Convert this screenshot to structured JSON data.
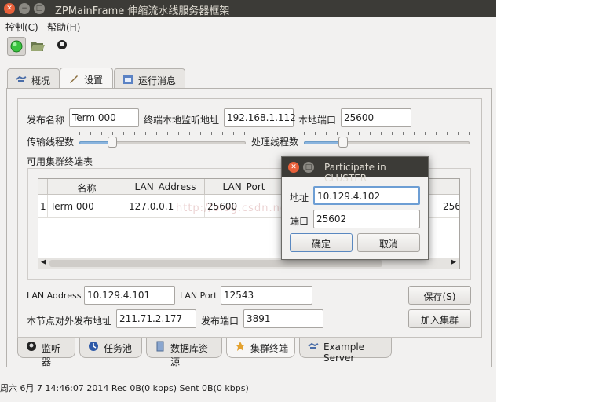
{
  "window": {
    "title": "ZPMainFrame 伸缩流水线服务器框架"
  },
  "menu": {
    "items": [
      "控制(C)",
      "帮助(H)"
    ]
  },
  "toolbar": {
    "icons": [
      "status-green-icon",
      "folder-open-icon",
      "user-icon"
    ]
  },
  "top_tabs": [
    {
      "label": "概况",
      "icon": "handshake-icon"
    },
    {
      "label": "设置",
      "icon": "brush-icon"
    },
    {
      "label": "运行消息",
      "icon": "calendar-icon"
    }
  ],
  "active_top_tab": "设置",
  "settings": {
    "publish_name_label": "发布名称",
    "publish_name_value": "Term 000",
    "listen_addr_label": "终端本地监听地址",
    "listen_addr_value": "192.168.1.112",
    "local_port_label": "本地端口",
    "local_port_value": "25600",
    "trans_threads_label": "传输线程数",
    "trans_threads_level": 0.18,
    "proc_threads_label": "处理线程数",
    "proc_threads_level": 0.22,
    "cluster_table_label": "可用集群终端表"
  },
  "cluster_table": {
    "headers": [
      "名称",
      "LAN_Address",
      "LAN_Port"
    ],
    "rows": [
      {
        "index": "1",
        "name": "Term 000",
        "lan_address": "127.0.0.1",
        "lan_port": "25600",
        "extra": "256"
      }
    ]
  },
  "lan": {
    "address_label": "LAN Address",
    "address_value": "10.129.4.101",
    "port_label": "LAN Port",
    "port_value": "12543",
    "pub_addr_label": "本节点对外发布地址",
    "pub_addr_value": "211.71.2.177",
    "pub_port_label": "发布端口",
    "pub_port_value": "3891",
    "save_button": "保存(S)",
    "join_button": "加入集群"
  },
  "bottom_tabs": [
    {
      "label": "监听器",
      "icon": "listener-icon"
    },
    {
      "label": "任务池",
      "icon": "task-pool-icon"
    },
    {
      "label": "数据库资源",
      "icon": "database-icon"
    },
    {
      "label": "集群终端",
      "icon": "cluster-icon"
    },
    {
      "label": "Example Server",
      "icon": "handshake-icon"
    }
  ],
  "active_bottom_tab": "集群终端",
  "status_bar": {
    "text": "周六 6月 7 14:46:07 2014 Rec 0B(0 kbps)  Sent 0B(0 kbps)"
  },
  "dialog": {
    "title": "Participate in CLUSTER",
    "address_label": "地址",
    "address_value": "10.129.4.102",
    "port_label": "端口",
    "port_value": "25602",
    "ok_button": "确定",
    "cancel_button": "取消"
  },
  "watermark": "http://blog.csdn.net/goldenhawking"
}
